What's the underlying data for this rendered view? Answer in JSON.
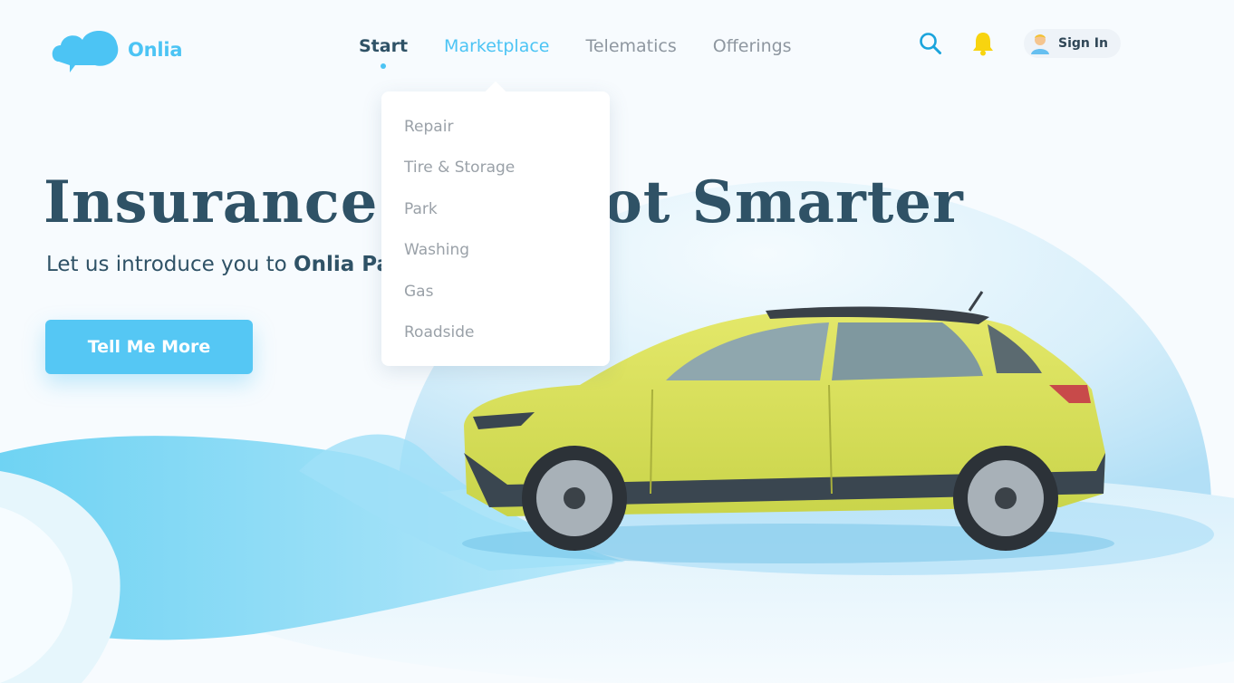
{
  "brand": {
    "name": "Onlia",
    "accent": "#4cc4f4",
    "dark": "#2f5266"
  },
  "nav": {
    "items": [
      {
        "label": "Start",
        "state": "active"
      },
      {
        "label": "Marketplace",
        "state": "open"
      },
      {
        "label": "Telematics",
        "state": "default"
      },
      {
        "label": "Offerings",
        "state": "default"
      }
    ]
  },
  "header": {
    "search_icon": "search-icon",
    "notification_icon": "bell-icon",
    "signin_label": "Sign In"
  },
  "dropdown": {
    "items": [
      "Repair",
      "Tire & Storage",
      "Park",
      "Washing",
      "Gas",
      "Roadside"
    ]
  },
  "hero": {
    "title": "Insurance Just Got Smarter",
    "subtitle_prefix": "Let us introduce you to ",
    "subtitle_bold": "Onlia PayPerKm Auto",
    "subtitle_suffix": ".",
    "cta_label": "Tell Me More"
  }
}
